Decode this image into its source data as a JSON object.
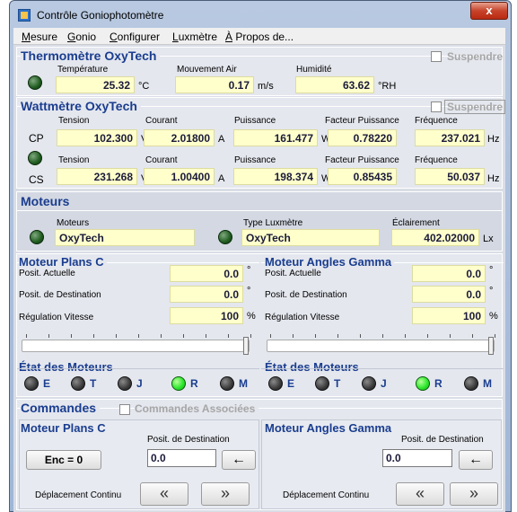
{
  "window": {
    "title": "Contrôle Goniophotomètre",
    "close": "x"
  },
  "menu": [
    {
      "label": "Mesure",
      "u": "M",
      "rest": "esure"
    },
    {
      "label": "Gonio",
      "u": "G",
      "rest": "onio"
    },
    {
      "label": "Configurer",
      "u": "C",
      "rest": "onfigurer"
    },
    {
      "label": "Luxmètre",
      "u": "L",
      "rest": "uxmètre"
    },
    {
      "label": "À Propos de...",
      "u": "À",
      "rest": " Propos de..."
    }
  ],
  "thermo": {
    "title": "Thermomètre   OxyTech",
    "suspend": "Suspendre",
    "temp_label": "Température",
    "temp": "25.32",
    "temp_unit": "°C",
    "air_label": "Mouvement Air",
    "air": "0.17",
    "air_unit": "m/s",
    "hum_label": "Humidité",
    "hum": "63.62",
    "hum_unit": "°RH"
  },
  "watt": {
    "title": "Wattmètre   OxyTech",
    "suspend": "Suspendre",
    "cp": {
      "tag": "CP",
      "tension_label": "Tension",
      "tension": "102.300",
      "tension_unit": "V",
      "courant_label": "Courant",
      "courant": "2.01800",
      "courant_unit": "A",
      "puissance_label": "Puissance",
      "puissance": "161.477",
      "puissance_unit": "W",
      "fp_label": "Facteur Puissance",
      "fp": "0.78220",
      "freq_label": "Fréquence",
      "freq": "237.021",
      "freq_unit": "Hz"
    },
    "cs": {
      "tag": "CS",
      "tension_label": "Tension",
      "tension": "231.268",
      "tension_unit": "V",
      "courant_label": "Courant",
      "courant": "1.00400",
      "courant_unit": "A",
      "puissance_label": "Puissance",
      "puissance": "198.374",
      "puissance_unit": "W",
      "fp_label": "Facteur Puissance",
      "fp": "0.85435",
      "freq_label": "Fréquence",
      "freq": "50.037",
      "freq_unit": "Hz"
    }
  },
  "moteurs": {
    "title": "Moteurs",
    "moteurs_label": "Moteurs",
    "moteurs_value": "OxyTech",
    "lux_label": "Type Luxmètre",
    "lux_value": "OxyTech",
    "ecl_label": "Éclairement",
    "ecl_value": "402.02000",
    "ecl_unit": "Lx"
  },
  "planC": {
    "title": "Moteur Plans C",
    "pos_label": "Posit. Actuelle",
    "pos": "0.0",
    "pos_unit": "°",
    "dest_label": "Posit. de Destination",
    "dest": "0.0",
    "dest_unit": "°",
    "reg_label": "Régulation Vitesse",
    "reg": "100",
    "reg_unit": "%",
    "slider_value": 100,
    "etat_title": "État des Moteurs",
    "leds": [
      {
        "l": "E",
        "s": "off"
      },
      {
        "l": "T",
        "s": "off"
      },
      {
        "l": "J",
        "s": "off"
      },
      {
        "l": "R",
        "s": "on"
      },
      {
        "l": "M",
        "s": "off"
      }
    ]
  },
  "gamma": {
    "title": "Moteur Angles Gamma",
    "pos_label": "Posit. Actuelle",
    "pos": "0.0",
    "pos_unit": "°",
    "dest_label": "Posit. de Destination",
    "dest": "0.0",
    "dest_unit": "°",
    "reg_label": "Régulation Vitesse",
    "reg": "100",
    "reg_unit": "%",
    "slider_value": 100,
    "etat_title": "État des Moteurs",
    "leds": [
      {
        "l": "E",
        "s": "off"
      },
      {
        "l": "T",
        "s": "off"
      },
      {
        "l": "J",
        "s": "off"
      },
      {
        "l": "R",
        "s": "on"
      },
      {
        "l": "M",
        "s": "off"
      }
    ]
  },
  "commandes": {
    "title": "Commandes",
    "assoc": "Commandes Associées",
    "planC": {
      "title": "Moteur Plans C",
      "dest_label": "Posit. de Destination",
      "enc": "Enc = 0",
      "dest": "0.0",
      "go": "←",
      "cont": "Déplacement Continu",
      "prev": "«",
      "next": "»"
    },
    "gamma": {
      "title": "Moteur Angles Gamma",
      "dest_label": "Posit. de Destination",
      "dest": "0.0",
      "go": "←",
      "cont": "Déplacement Continu",
      "prev": "«",
      "next": "»"
    }
  }
}
